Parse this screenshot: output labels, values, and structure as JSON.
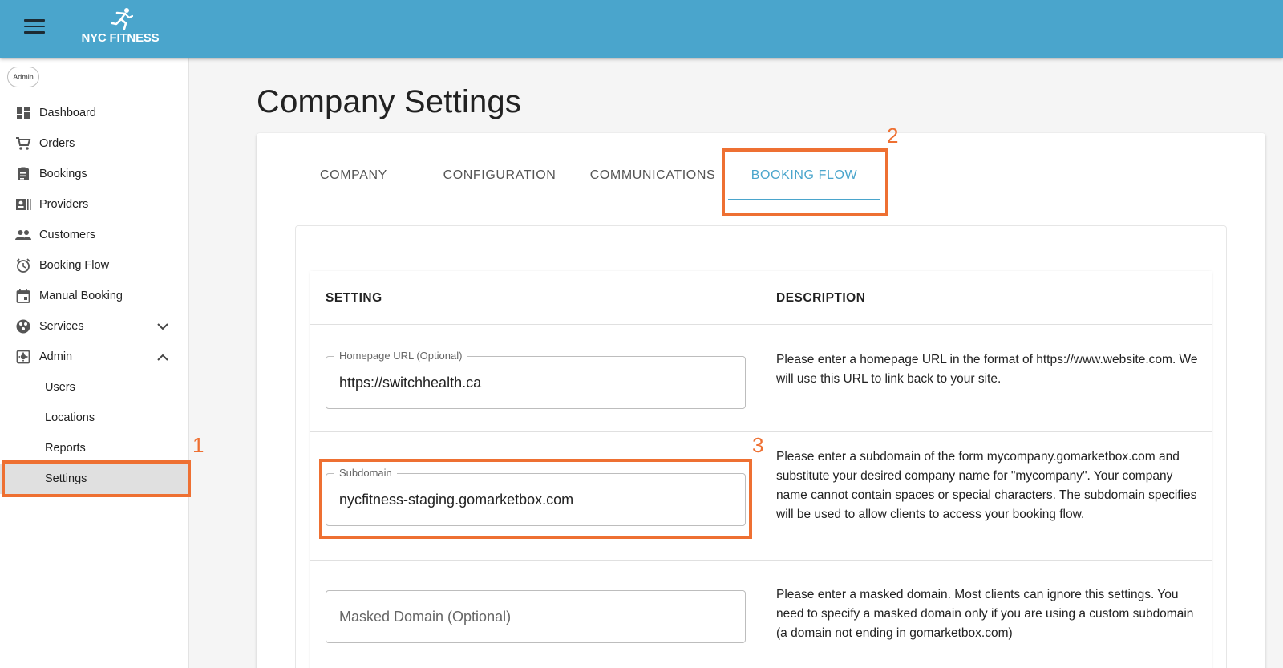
{
  "header": {
    "brand": "NYC FITNESS",
    "menu_icon": "hamburger-icon",
    "accent": "#4aa5cc"
  },
  "sidebar": {
    "role": "Admin",
    "items": [
      {
        "label": "Dashboard",
        "icon": "dashboard-icon"
      },
      {
        "label": "Orders",
        "icon": "cart-icon"
      },
      {
        "label": "Bookings",
        "icon": "clipboard-icon"
      },
      {
        "label": "Providers",
        "icon": "id-card-icon"
      },
      {
        "label": "Customers",
        "icon": "people-icon"
      },
      {
        "label": "Booking Flow",
        "icon": "alarm-icon"
      },
      {
        "label": "Manual Booking",
        "icon": "calendar-icon"
      },
      {
        "label": "Services",
        "icon": "services-icon",
        "expanded": false
      },
      {
        "label": "Admin",
        "icon": "admin-icon",
        "expanded": true
      }
    ],
    "admin_sub": [
      {
        "label": "Users"
      },
      {
        "label": "Locations"
      },
      {
        "label": "Reports"
      },
      {
        "label": "Settings",
        "active": true
      }
    ]
  },
  "main": {
    "title": "Company Settings",
    "tabs": [
      {
        "label": "COMPANY"
      },
      {
        "label": "CONFIGURATION"
      },
      {
        "label": "COMMUNICATIONS"
      },
      {
        "label": "BOOKING FLOW",
        "active": true
      }
    ],
    "table": {
      "headers": {
        "setting": "SETTING",
        "description": "DESCRIPTION"
      },
      "rows": [
        {
          "field_label": "Homepage URL (Optional)",
          "field_value": "https://switchhealth.ca",
          "description": "Please enter a homepage URL in the format of https://www.website.com. We will use this URL to link back to your site."
        },
        {
          "field_label": "Subdomain",
          "field_value": "nycfitness-staging.gomarketbox.com",
          "description": "Please enter a subdomain of the form mycompany.gomarketbox.com and substitute your desired company name for \"mycompany\". Your company name cannot contain spaces or special characters. The subdomain specifies will be used to allow clients to access your booking flow."
        },
        {
          "field_placeholder": "Masked Domain (Optional)",
          "description": "Please enter a masked domain. Most clients can ignore this settings. You need to specify a masked domain only if you are using a custom subdomain (a domain not ending in gomarketbox.com)"
        }
      ]
    }
  },
  "annotations": {
    "color": "#ee7032",
    "labels": [
      "1",
      "2",
      "3"
    ]
  }
}
